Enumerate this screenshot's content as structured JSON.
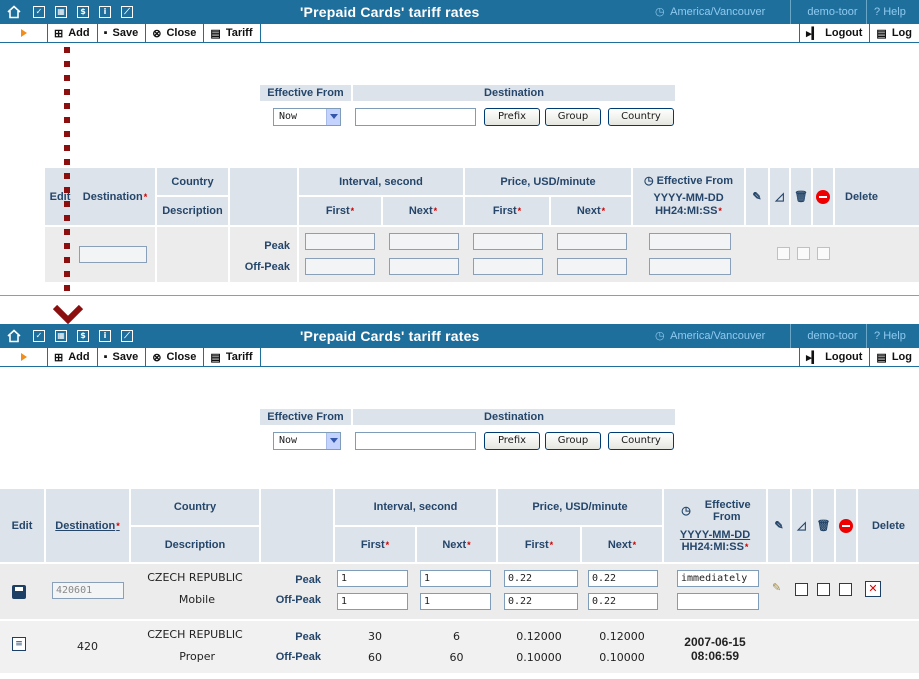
{
  "titlebar": {
    "title": "'Prepaid Cards' tariff rates",
    "timezone": "America/Vancouver",
    "user": "demo-toor",
    "help": "Help",
    "icons": [
      "home-icon",
      "checkbox-icon",
      "grid-icon",
      "dollar-icon",
      "info-icon",
      "chart-icon"
    ]
  },
  "toolbar": {
    "add": "Add",
    "save": "Save",
    "close": "Close",
    "tariff": "Tariff",
    "logout": "Logout",
    "log": "Log"
  },
  "filter": {
    "effective_from_label": "Effective From",
    "destination_label": "Destination",
    "effective_from_value": "Now",
    "destination_value": "",
    "prefix_btn": "Prefix",
    "group_btn": "Group",
    "country_btn": "Country"
  },
  "table": {
    "edit": "Edit",
    "destination": "Destination",
    "country": "Country",
    "description": "Description",
    "interval": "Interval, second",
    "price": "Price, USD/minute",
    "first": "First",
    "next": "Next",
    "effective_from": "Effective From",
    "date_format_1": "YYYY-MM-DD",
    "date_format_2": "HH24:MI:SS",
    "delete": "Delete",
    "peak": "Peak",
    "offpeak": "Off-Peak"
  },
  "rows": {
    "edit_row": {
      "destination": "420601",
      "country": "CZECH REPUBLIC",
      "description": "Mobile",
      "interval_first_peak": "1",
      "interval_first_offpeak": "1",
      "interval_next_peak": "1",
      "interval_next_offpeak": "1",
      "price_first_peak": "0.22",
      "price_first_offpeak": "0.22",
      "price_next_peak": "0.22",
      "price_next_offpeak": "0.22",
      "effective_from": "immediately"
    },
    "view_row": {
      "destination": "420",
      "country": "CZECH REPUBLIC",
      "description": "Proper",
      "interval_first_peak": "30",
      "interval_first_offpeak": "60",
      "interval_next_peak": "6",
      "interval_next_offpeak": "60",
      "price_first_peak": "0.12000",
      "price_first_offpeak": "0.10000",
      "price_next_peak": "0.12000",
      "price_next_offpeak": "0.10000",
      "effective_date": "2007-06-15",
      "effective_time": "08:06:59"
    }
  },
  "colors": {
    "titlebar": "#1f6f9c",
    "header_cell": "#dde3ea",
    "header_text": "#25466a",
    "required": "#d00000",
    "connector": "#8b0f0f"
  }
}
